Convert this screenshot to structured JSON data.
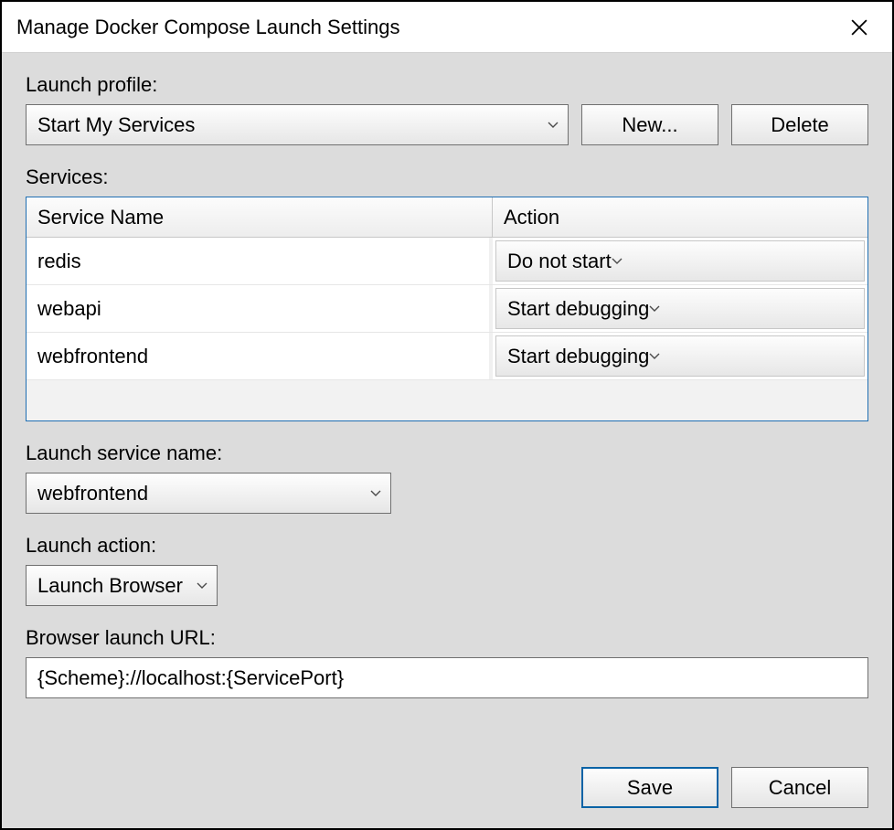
{
  "title": "Manage Docker Compose Launch Settings",
  "labels": {
    "launch_profile": "Launch profile:",
    "services": "Services:",
    "launch_service_name": "Launch service name:",
    "launch_action": "Launch action:",
    "browser_launch_url": "Browser launch URL:"
  },
  "profile": {
    "selected": "Start My Services"
  },
  "buttons": {
    "new": "New...",
    "delete": "Delete",
    "save": "Save",
    "cancel": "Cancel"
  },
  "services_table": {
    "headers": {
      "name": "Service Name",
      "action": "Action"
    },
    "rows": [
      {
        "name": "redis",
        "action": "Do not start"
      },
      {
        "name": "webapi",
        "action": "Start debugging"
      },
      {
        "name": "webfrontend",
        "action": "Start debugging"
      }
    ]
  },
  "launch_service_name": {
    "selected": "webfrontend"
  },
  "launch_action": {
    "selected": "Launch Browser"
  },
  "browser_launch_url": "{Scheme}://localhost:{ServicePort}"
}
